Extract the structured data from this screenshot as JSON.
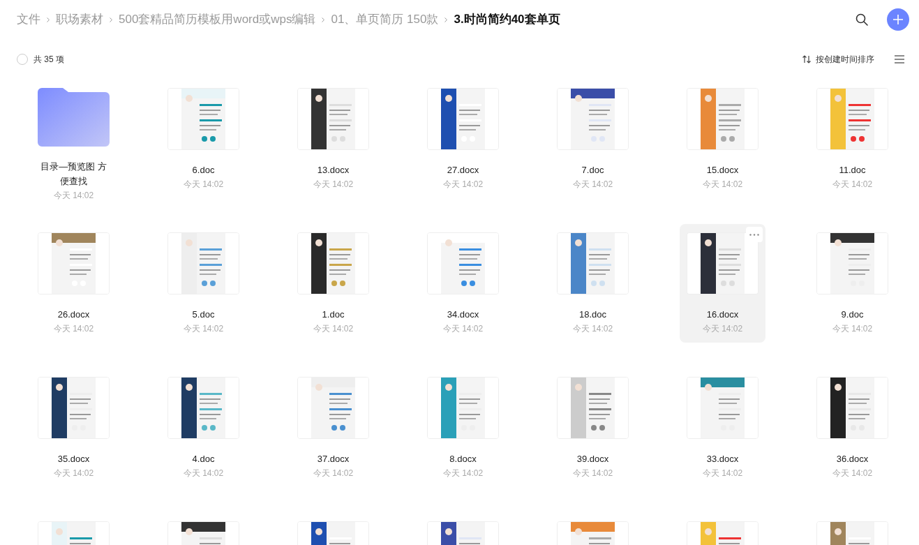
{
  "breadcrumb": [
    {
      "label": "文件",
      "current": false
    },
    {
      "label": "职场素材",
      "current": false
    },
    {
      "label": "500套精品简历模板用word或wps编辑",
      "current": false
    },
    {
      "label": "01、单页简历 150款",
      "current": false
    },
    {
      "label": "3.时尚简约40套单页",
      "current": true
    }
  ],
  "all_selected": false,
  "count_label": "共 35 项",
  "sort_label": "按创建时间排序",
  "items": [
    {
      "kind": "folder",
      "name": "目录—预览图 方便查找",
      "time": "今天 14:02",
      "hovered": false
    },
    {
      "kind": "file",
      "name": "6.doc",
      "time": "今天 14:02",
      "hovered": false
    },
    {
      "kind": "file",
      "name": "13.docx",
      "time": "今天 14:02",
      "hovered": false
    },
    {
      "kind": "file",
      "name": "27.docx",
      "time": "今天 14:02",
      "hovered": false
    },
    {
      "kind": "file",
      "name": "7.doc",
      "time": "今天 14:02",
      "hovered": false
    },
    {
      "kind": "file",
      "name": "15.docx",
      "time": "今天 14:02",
      "hovered": false
    },
    {
      "kind": "file",
      "name": "11.doc",
      "time": "今天 14:02",
      "hovered": false
    },
    {
      "kind": "file",
      "name": "26.docx",
      "time": "今天 14:02",
      "hovered": false
    },
    {
      "kind": "file",
      "name": "5.doc",
      "time": "今天 14:02",
      "hovered": false
    },
    {
      "kind": "file",
      "name": "1.doc",
      "time": "今天 14:02",
      "hovered": false
    },
    {
      "kind": "file",
      "name": "34.docx",
      "time": "今天 14:02",
      "hovered": false
    },
    {
      "kind": "file",
      "name": "18.doc",
      "time": "今天 14:02",
      "hovered": false
    },
    {
      "kind": "file",
      "name": "16.docx",
      "time": "今天 14:02",
      "hovered": true
    },
    {
      "kind": "file",
      "name": "9.doc",
      "time": "今天 14:02",
      "hovered": false
    },
    {
      "kind": "file",
      "name": "35.docx",
      "time": "今天 14:02",
      "hovered": false
    },
    {
      "kind": "file",
      "name": "4.doc",
      "time": "今天 14:02",
      "hovered": false
    },
    {
      "kind": "file",
      "name": "37.docx",
      "time": "今天 14:02",
      "hovered": false
    },
    {
      "kind": "file",
      "name": "8.docx",
      "time": "今天 14:02",
      "hovered": false
    },
    {
      "kind": "file",
      "name": "39.docx",
      "time": "今天 14:02",
      "hovered": false
    },
    {
      "kind": "file",
      "name": "33.docx",
      "time": "今天 14:02",
      "hovered": false
    },
    {
      "kind": "file",
      "name": "36.docx",
      "time": "今天 14:02",
      "hovered": false
    },
    {
      "kind": "file"
    },
    {
      "kind": "file"
    },
    {
      "kind": "file"
    },
    {
      "kind": "file"
    },
    {
      "kind": "file"
    },
    {
      "kind": "file"
    },
    {
      "kind": "file"
    }
  ]
}
